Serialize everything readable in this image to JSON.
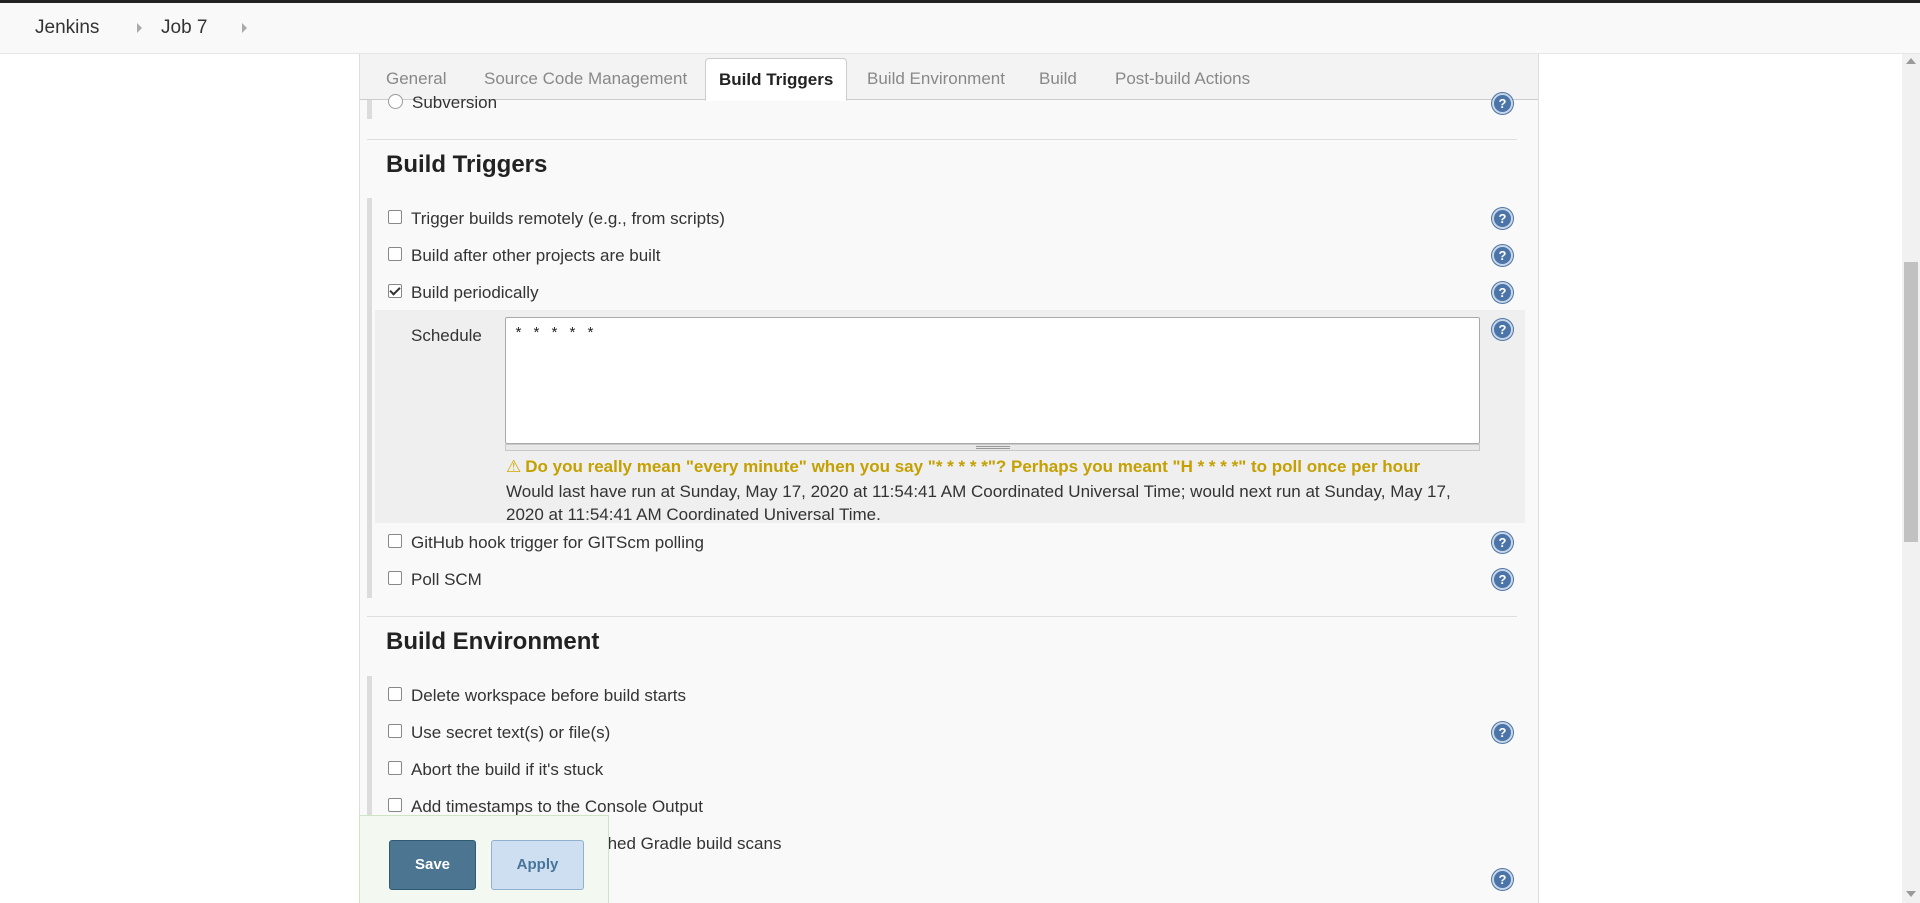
{
  "breadcrumb": {
    "root": "Jenkins",
    "job": "Job 7"
  },
  "tabs": [
    {
      "label": "General"
    },
    {
      "label": "Source Code Management"
    },
    {
      "label": "Build Triggers"
    },
    {
      "label": "Build Environment"
    },
    {
      "label": "Build"
    },
    {
      "label": "Post-build Actions"
    }
  ],
  "active_tab": "Build Triggers",
  "scm": {
    "subversion_label": "Subversion"
  },
  "build_triggers": {
    "title": "Build Triggers",
    "items": [
      {
        "label": "Trigger builds remotely (e.g., from scripts)",
        "checked": false
      },
      {
        "label": "Build after other projects are built",
        "checked": false
      },
      {
        "label": "Build periodically",
        "checked": true
      },
      {
        "label": "GitHub hook trigger for GITScm polling",
        "checked": false
      },
      {
        "label": "Poll SCM",
        "checked": false
      }
    ],
    "schedule": {
      "label": "Schedule",
      "value": "* * * * *",
      "warning": "Do you really mean \"every minute\" when you say \"* * * * *\"? Perhaps you meant \"H * * * *\" to poll once per hour",
      "info": "Would last have run at Sunday, May 17, 2020 at 11:54:41 AM Coordinated Universal Time; would next run at Sunday, May 17, 2020 at 11:54:41 AM Coordinated Universal Time."
    }
  },
  "build_environment": {
    "title": "Build Environment",
    "items": [
      {
        "label": "Delete workspace before build starts",
        "checked": false
      },
      {
        "label": "Use secret text(s) or file(s)",
        "checked": false
      },
      {
        "label": "Abort the build if it's stuck",
        "checked": false
      },
      {
        "label": "Add timestamps to the Console Output",
        "checked": false
      },
      {
        "label": "Inspect build log for published Gradle build scans",
        "checked": false
      }
    ]
  },
  "actions": {
    "save": "Save",
    "apply": "Apply"
  },
  "help_icon": "question-mark-icon",
  "colors": {
    "save": "#4b7590",
    "apply": "#cddff0",
    "warning": "#c4a000",
    "help": "#4b74a8"
  }
}
